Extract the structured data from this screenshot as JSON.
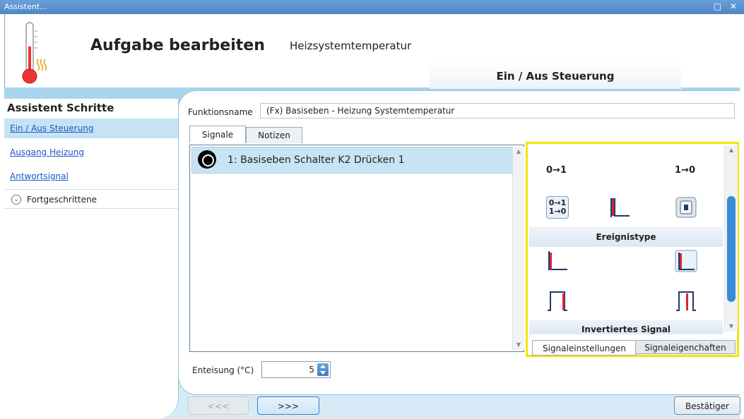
{
  "window": {
    "title": "Assistent...",
    "controls": "□ ✕"
  },
  "header": {
    "title": "Aufgabe bearbeiten",
    "subtitle": "Heizsystemtemperatur",
    "section_tab": "Ein / Aus Steuerung"
  },
  "sidebar": {
    "title": "Assistent Schritte",
    "items": [
      {
        "label": "Ein / Aus Steuerung",
        "selected": true
      },
      {
        "label": "Ausgang Heizung",
        "selected": false
      },
      {
        "label": "Antwortsignal",
        "selected": false
      }
    ],
    "advanced_label": "Fortgeschrittene"
  },
  "main": {
    "function_name_label": "Funktionsname",
    "function_name_value": "(Fx) Basiseben - Heizung Systemtemperatur",
    "tabs": [
      {
        "label": "Signale",
        "active": true
      },
      {
        "label": "Notizen",
        "active": false
      }
    ],
    "signal": "1: Basiseben Schalter K2 Drücken 1",
    "event_panel": {
      "icons": [
        "rising-edge-icon",
        "falling-edge-icon",
        "both-edges-icon",
        "pulse-high-icon",
        "panel-device-icon",
        "step-low-icon",
        "step-high-icon",
        "pulse-icon",
        "pulse-inverted-icon"
      ],
      "rising_label": "0→1",
      "falling_label": "1→0",
      "both_label_top": "0→1",
      "both_label_bottom": "1→0",
      "group1_label": "Ereignistype",
      "group2_label": "Invertiertes Signal",
      "bottom_tabs": [
        {
          "label": "Signaleinstellungen",
          "active": true
        },
        {
          "label": "Signaleigenchaften",
          "active": false
        }
      ]
    },
    "enteisung_label": "Enteisung (°C)",
    "enteisung_value": "5"
  },
  "footer": {
    "prev_label": "<<<",
    "next_label": ">>>",
    "confirm_label": "Bestätiger"
  },
  "colors": {
    "accent": "#3a7bc8",
    "highlight": "#f2e600",
    "signal_red": "#e0203a",
    "link": "#1a56c9"
  }
}
